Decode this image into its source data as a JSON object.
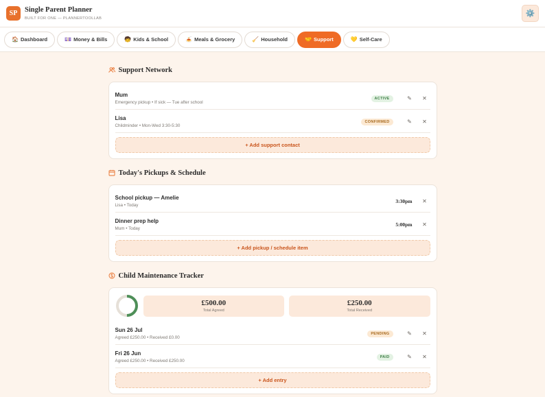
{
  "header": {
    "logo": "SP",
    "title": "Single Parent Planner",
    "subtitle": "BUILT FOR ONE — PLANNERTOOLLAB",
    "settings_icon": "⚙️"
  },
  "nav": {
    "tabs": [
      {
        "icon": "🏠",
        "label": "Dashboard"
      },
      {
        "icon": "💷",
        "label": "Money & Bills"
      },
      {
        "icon": "🧒",
        "label": "Kids & School"
      },
      {
        "icon": "🍝",
        "label": "Meals & Grocery"
      },
      {
        "icon": "🧹",
        "label": "Household"
      },
      {
        "icon": "🤝",
        "label": "Support"
      },
      {
        "icon": "💛",
        "label": "Self-Care"
      }
    ],
    "active_index": 5
  },
  "support": {
    "title": "Support Network",
    "contacts": [
      {
        "name": "Mum",
        "detail": "Emergency pickup • If sick — Tue after school",
        "status": "ACTIVE"
      },
      {
        "name": "Lisa",
        "detail": "Childminder • Mon-Wed 3:30-5:30",
        "status": "CONFIRMED"
      }
    ],
    "add_label": "+ Add support contact"
  },
  "schedule": {
    "title": "Today's Pickups & Schedule",
    "items": [
      {
        "name": "School pickup — Amelie",
        "detail": "Lisa • Today",
        "time": "3:30pm"
      },
      {
        "name": "Dinner prep help",
        "detail": "Mum • Today",
        "time": "5:00pm"
      }
    ],
    "add_label": "+ Add pickup / schedule item"
  },
  "maintenance": {
    "title": "Child Maintenance Tracker",
    "received_fraction": 0.5,
    "total_agreed": "£500.00",
    "total_agreed_label": "Total Agreed",
    "total_received": "£250.00",
    "total_received_label": "Total Received",
    "entries": [
      {
        "date": "Sun 26 Jul",
        "detail": "Agreed £250.00 • Received £0.00",
        "status": "PENDING"
      },
      {
        "date": "Fri 26 Jun",
        "detail": "Agreed £250.00 • Received £250.00",
        "status": "PAID"
      }
    ],
    "add_label": "+ Add entry"
  },
  "icons": {
    "edit": "✎",
    "delete": "✕"
  },
  "colors": {
    "accent": "#ef6b25",
    "ring_fill": "#4e8f58",
    "ring_track": "#e6e0d8"
  }
}
